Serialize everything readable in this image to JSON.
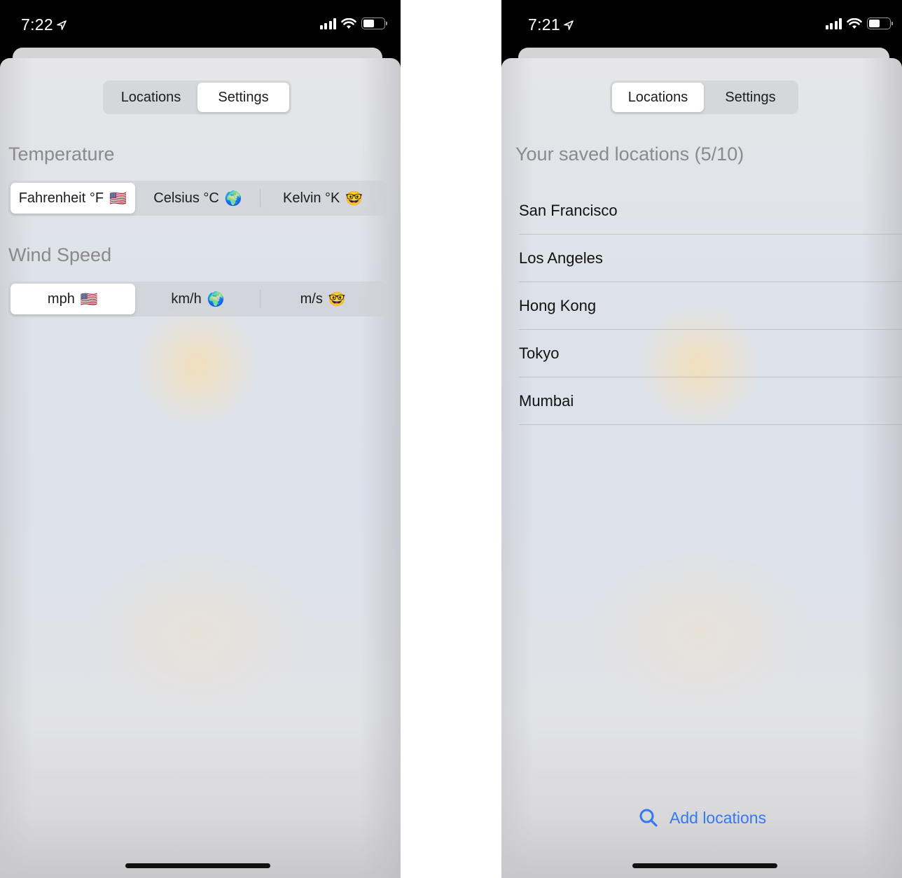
{
  "screens": {
    "settings": {
      "status_bar": {
        "time": "7:22"
      },
      "top_tabs": [
        {
          "label": "Locations",
          "active": false
        },
        {
          "label": "Settings",
          "active": true
        }
      ],
      "temperature": {
        "title": "Temperature",
        "options": [
          {
            "label": "Fahrenheit °F",
            "emoji": "🇺🇸",
            "active": true
          },
          {
            "label": "Celsius °C",
            "emoji": "🌍",
            "active": false
          },
          {
            "label": "Kelvin °K",
            "emoji": "🤓",
            "active": false
          }
        ]
      },
      "wind_speed": {
        "title": "Wind Speed",
        "options": [
          {
            "label": "mph",
            "emoji": "🇺🇸",
            "active": true
          },
          {
            "label": "km/h",
            "emoji": "🌍",
            "active": false
          },
          {
            "label": "m/s",
            "emoji": "🤓",
            "active": false
          }
        ]
      }
    },
    "locations": {
      "status_bar": {
        "time": "7:21"
      },
      "top_tabs": [
        {
          "label": "Locations",
          "active": true
        },
        {
          "label": "Settings",
          "active": false
        }
      ],
      "list_title": "Your saved locations (5/10)",
      "items": [
        "San Francisco",
        "Los Angeles",
        "Hong Kong",
        "Tokyo",
        "Mumbai"
      ],
      "add_button": {
        "label": "Add locations",
        "icon": "search-icon",
        "color": "#3478f6"
      }
    }
  }
}
